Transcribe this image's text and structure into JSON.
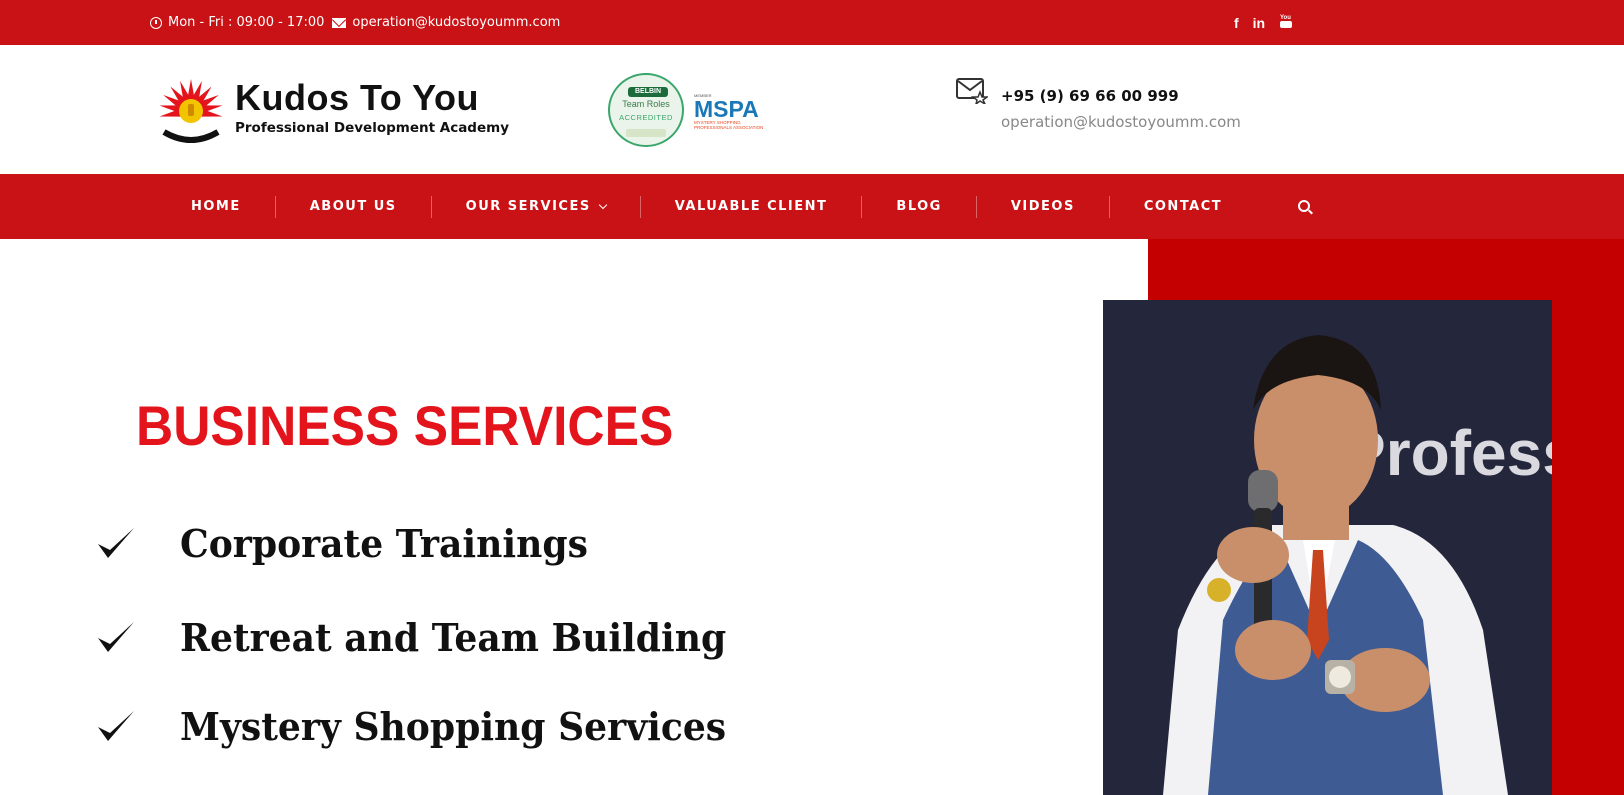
{
  "topbar": {
    "hours": "Mon - Fri : 09:00 - 17:00",
    "email": "operation@kudostoyoumm.com",
    "social": [
      {
        "name": "facebook-icon",
        "label": "f"
      },
      {
        "name": "linkedin-icon",
        "label": "in"
      },
      {
        "name": "youtube-icon",
        "label": "▶"
      }
    ]
  },
  "header": {
    "brand_title": "Kudos To You",
    "brand_subtitle": "Professional Development Academy",
    "badge_belbin": {
      "top": "BELBIN",
      "middle": "Team Roles",
      "bottom": "ACCREDITED"
    },
    "badge_mspa": {
      "top": "MEMBER",
      "middle": "MSPA",
      "bottom": "MYSTERY SHOPPING PROFESSIONALS ASSOCIATION"
    },
    "phone": "+95 (9) 69 66 00 999",
    "email": "operation@kudostoyoumm.com"
  },
  "nav": {
    "items": [
      "HOME",
      "ABOUT US",
      "OUR SERVICES",
      "VALUABLE CLIENT",
      "BLOG",
      "VIDEOS",
      "CONTACT"
    ]
  },
  "hero": {
    "title": "BUSINESS SERVICES",
    "services": [
      "Corporate Trainings",
      "Retreat and Team Building",
      "Mystery Shopping Services"
    ],
    "photo_backdrop_text": "Profess"
  },
  "colors": {
    "brand_red": "#c91216",
    "hero_red": "#c40000",
    "title_red": "#e3141b"
  }
}
